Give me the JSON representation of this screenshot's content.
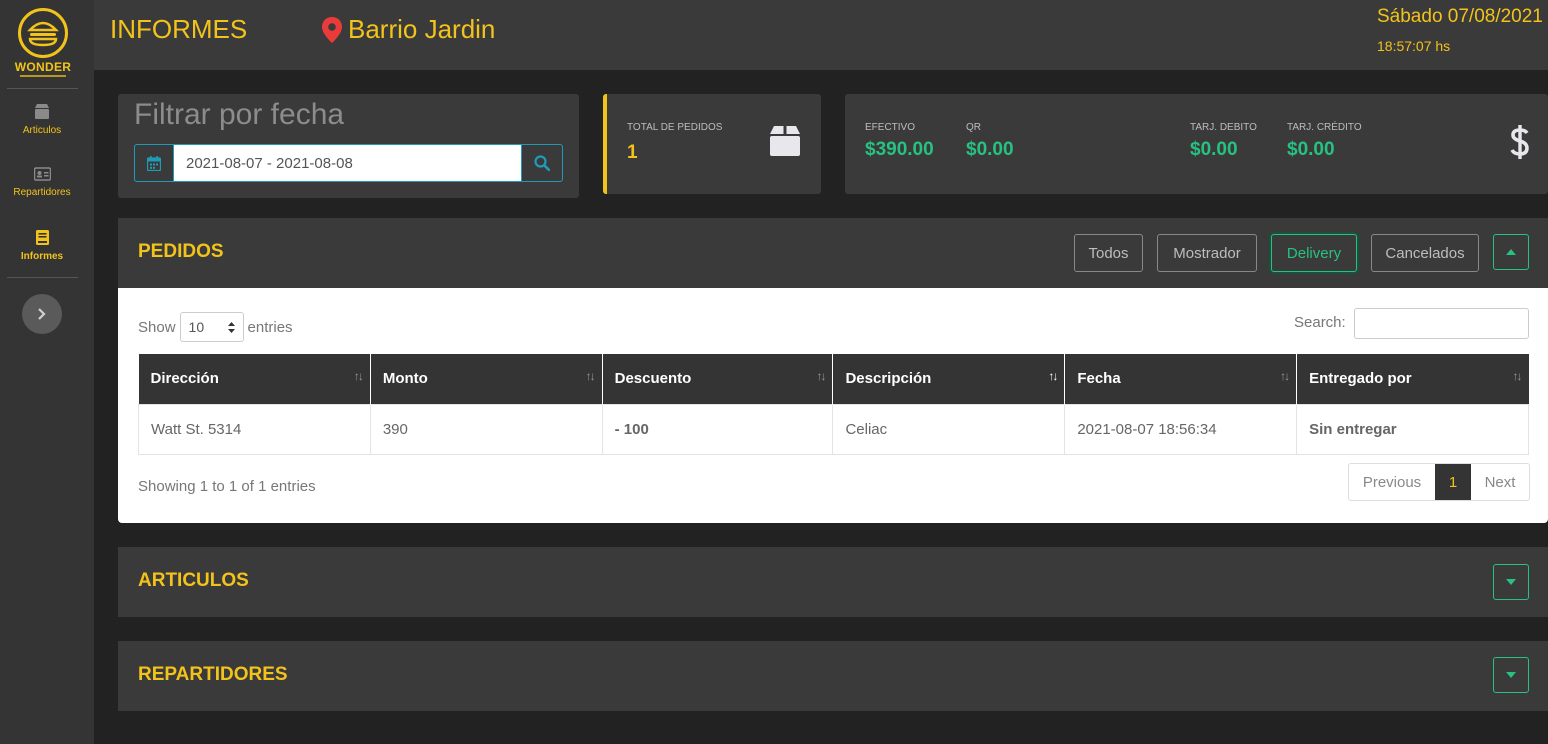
{
  "brand": {
    "name": "WONDER"
  },
  "sidebar": {
    "items": [
      {
        "label": "Articulos",
        "icon": "box-icon"
      },
      {
        "label": "Repartidores",
        "icon": "id-card-icon"
      },
      {
        "label": "Informes",
        "icon": "book-icon"
      }
    ]
  },
  "header": {
    "title": "INFORMES",
    "location": "Barrio Jardin",
    "date": "Sábado 07/08/2021",
    "time": "18:57:07 hs"
  },
  "filter": {
    "title": "Filtrar por fecha",
    "date_range": "2021-08-07 - 2021-08-08"
  },
  "totals": {
    "label": "TOTAL DE PEDIDOS",
    "value": "1"
  },
  "payments": [
    {
      "label": "EFECTIVO",
      "value": "$390.00"
    },
    {
      "label": "QR",
      "value": "$0.00"
    },
    {
      "label": "TARJ. DEBITO",
      "value": "$0.00"
    },
    {
      "label": "TARJ. CRÉDITO",
      "value": "$0.00"
    }
  ],
  "pedidos": {
    "title": "PEDIDOS",
    "filters": [
      "Todos",
      "Mostrador",
      "Delivery",
      "Cancelados"
    ],
    "active_filter": "Delivery",
    "show_label": "Show",
    "entries_label": "entries",
    "page_size": "10",
    "search_label": "Search:",
    "columns": [
      "Dirección",
      "Monto",
      "Descuento",
      "Descripción",
      "Fecha",
      "Entregado por"
    ],
    "rows": [
      [
        "Watt St. 5314",
        "390",
        "- 100",
        "Celiac",
        "2021-08-07 18:56:34",
        "Sin entregar"
      ]
    ],
    "info": "Showing 1 to 1 of 1 entries",
    "pagination": {
      "prev": "Previous",
      "page": "1",
      "next": "Next"
    }
  },
  "articulos": {
    "title": "ARTICULOS"
  },
  "repartidores": {
    "title": "REPARTIDORES"
  },
  "colors": {
    "accent": "#f2c31a",
    "success": "#26c281",
    "danger": "#e33b3b",
    "warning": "#f07a2a"
  }
}
